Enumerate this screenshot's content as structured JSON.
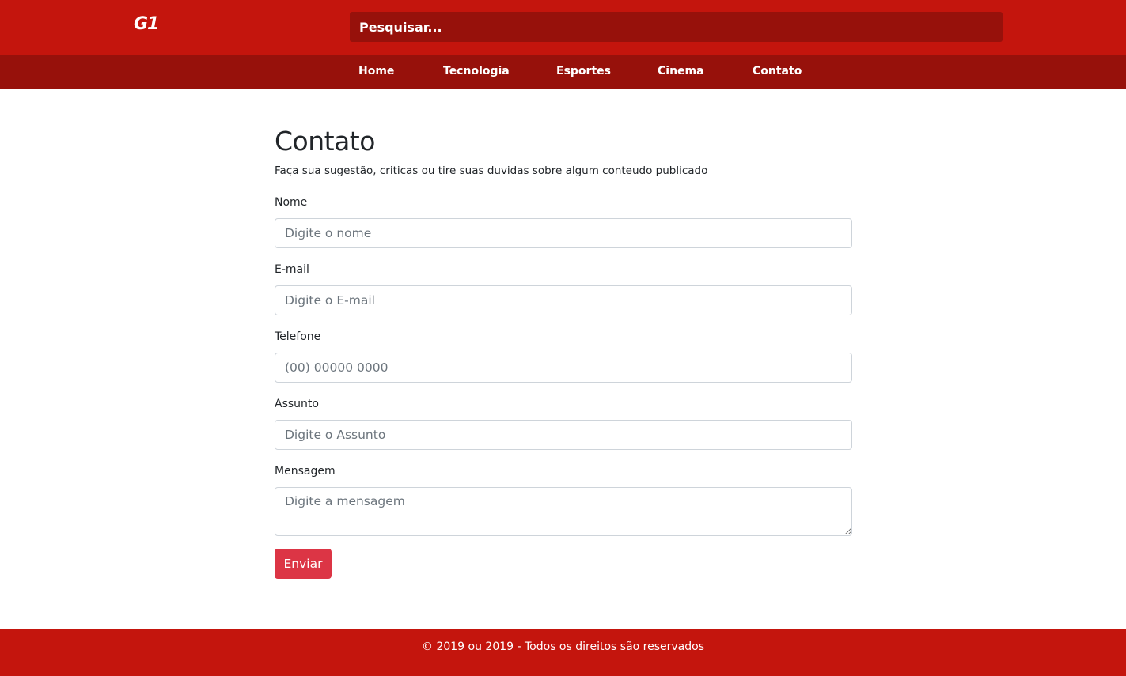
{
  "header": {
    "logo_text": "G1",
    "search_placeholder": "Pesquisar..."
  },
  "nav": {
    "items": [
      {
        "label": "Home"
      },
      {
        "label": "Tecnologia"
      },
      {
        "label": "Esportes"
      },
      {
        "label": "Cinema"
      },
      {
        "label": "Contato"
      }
    ]
  },
  "main": {
    "title": "Contato",
    "subtitle": "Faça sua sugestão, criticas ou tire suas duvidas sobre algum conteudo publicado",
    "fields": {
      "nome": {
        "label": "Nome",
        "placeholder": "Digite o nome",
        "value": ""
      },
      "email": {
        "label": "E-mail",
        "placeholder": "Digite o E-mail",
        "value": ""
      },
      "telefone": {
        "label": "Telefone",
        "placeholder": "(00) 00000 0000",
        "value": ""
      },
      "assunto": {
        "label": "Assunto",
        "placeholder": "Digite o Assunto",
        "value": ""
      },
      "mensagem": {
        "label": "Mensagem",
        "placeholder": "Digite a mensagem",
        "value": ""
      }
    },
    "submit_label": "Enviar"
  },
  "footer": {
    "text": "© 2019 ou 2019 - Todos os direitos são reservados"
  },
  "colors": {
    "brand_red": "#c4150d",
    "dark_red": "#97110b",
    "button_red": "#dc3545"
  }
}
